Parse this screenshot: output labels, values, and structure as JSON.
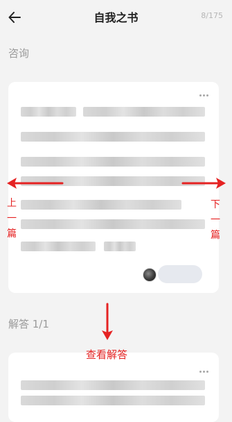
{
  "nav": {
    "title": "自我之书",
    "counter": "8/175"
  },
  "sections": {
    "consult_label": "咨询",
    "answer_label": "解答 1/1"
  },
  "annotations": {
    "prev_label": "上一篇",
    "prev_chars": [
      "上",
      "一",
      "篇"
    ],
    "next_label": "下一篇",
    "next_chars": [
      "下",
      "一",
      "篇"
    ],
    "view_answer": "查看解答",
    "color": "#e52323"
  },
  "icons": {
    "back": "back-arrow-icon",
    "more": "more-dots-icon"
  }
}
